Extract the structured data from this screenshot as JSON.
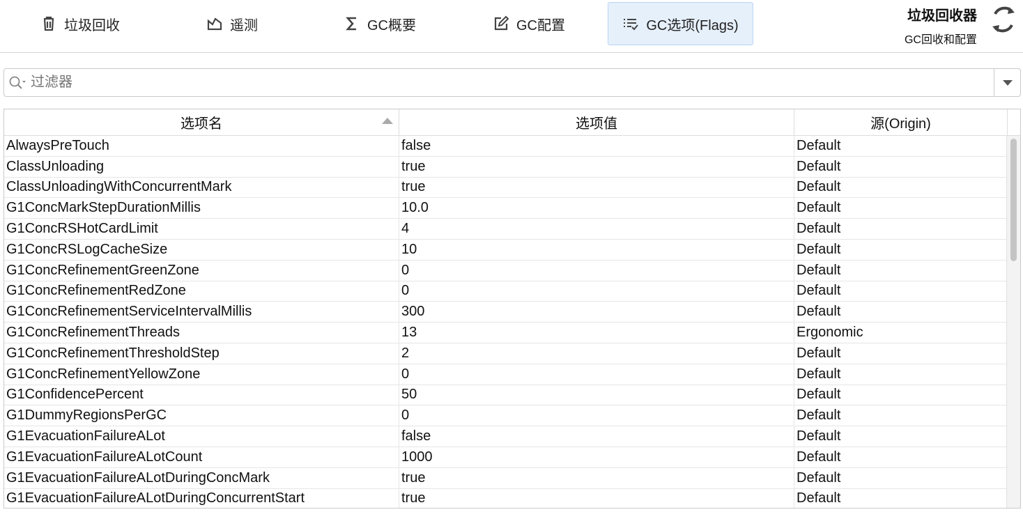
{
  "tabs": [
    {
      "label": "垃圾回收",
      "icon": "trash-icon"
    },
    {
      "label": "遥测",
      "icon": "chart-area-icon"
    },
    {
      "label": "GC概要",
      "icon": "sigma-icon"
    },
    {
      "label": "GC配置",
      "icon": "edit-icon"
    },
    {
      "label": "GC选项(Flags)",
      "icon": "list-check-icon",
      "active": true
    }
  ],
  "header": {
    "title": "垃圾回收器",
    "subtitle": "GC回收和配置"
  },
  "filter": {
    "placeholder": "过滤器"
  },
  "table": {
    "columns": [
      "选项名",
      "选项值",
      "源(Origin)"
    ],
    "rows": [
      [
        "AlwaysPreTouch",
        "false",
        "Default"
      ],
      [
        "ClassUnloading",
        "true",
        "Default"
      ],
      [
        "ClassUnloadingWithConcurrentMark",
        "true",
        "Default"
      ],
      [
        "G1ConcMarkStepDurationMillis",
        "10.0",
        "Default"
      ],
      [
        "G1ConcRSHotCardLimit",
        "4",
        "Default"
      ],
      [
        "G1ConcRSLogCacheSize",
        "10",
        "Default"
      ],
      [
        "G1ConcRefinementGreenZone",
        "0",
        "Default"
      ],
      [
        "G1ConcRefinementRedZone",
        "0",
        "Default"
      ],
      [
        "G1ConcRefinementServiceIntervalMillis",
        "300",
        "Default"
      ],
      [
        "G1ConcRefinementThreads",
        "13",
        "Ergonomic"
      ],
      [
        "G1ConcRefinementThresholdStep",
        "2",
        "Default"
      ],
      [
        "G1ConcRefinementYellowZone",
        "0",
        "Default"
      ],
      [
        "G1ConfidencePercent",
        "50",
        "Default"
      ],
      [
        "G1DummyRegionsPerGC",
        "0",
        "Default"
      ],
      [
        "G1EvacuationFailureALot",
        "false",
        "Default"
      ],
      [
        "G1EvacuationFailureALotCount",
        "1000",
        "Default"
      ],
      [
        "G1EvacuationFailureALotDuringConcMark",
        "true",
        "Default"
      ],
      [
        "G1EvacuationFailureALotDuringConcurrentStart",
        "true",
        "Default"
      ]
    ]
  }
}
